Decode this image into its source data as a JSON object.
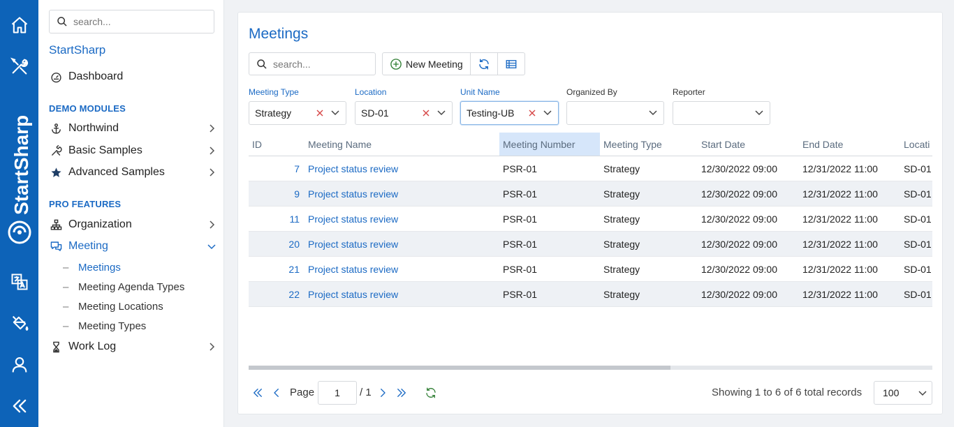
{
  "rail": {
    "brand": "StartSharp"
  },
  "sidebar": {
    "search_placeholder": "search...",
    "title": "StartSharp",
    "dashboard": "Dashboard",
    "section_demo": "DEMO MODULES",
    "northwind": "Northwind",
    "basic_samples": "Basic Samples",
    "advanced_samples": "Advanced Samples",
    "section_pro": "PRO FEATURES",
    "organization": "Organization",
    "meeting": "Meeting",
    "meeting_sub": [
      {
        "label": "Meetings"
      },
      {
        "label": "Meeting Agenda Types"
      },
      {
        "label": "Meeting Locations"
      },
      {
        "label": "Meeting Types"
      }
    ],
    "work_log": "Work Log"
  },
  "main": {
    "title": "Meetings",
    "search_placeholder": "search...",
    "new_button": "New Meeting",
    "filters": [
      {
        "label": "Meeting Type",
        "value": "Strategy"
      },
      {
        "label": "Location",
        "value": "SD-01"
      },
      {
        "label": "Unit Name",
        "value": "Testing-UB"
      },
      {
        "label": "Organized By",
        "value": ""
      },
      {
        "label": "Reporter",
        "value": ""
      }
    ],
    "columns": [
      "ID",
      "Meeting Name",
      "Meeting Number",
      "Meeting Type",
      "Start Date",
      "End Date",
      "Locati"
    ],
    "rows": [
      {
        "id": "7",
        "name": "Project status review",
        "number": "PSR-01",
        "type": "Strategy",
        "start": "12/30/2022 09:00",
        "end": "12/31/2022 11:00",
        "location": "SD-01"
      },
      {
        "id": "9",
        "name": "Project status review",
        "number": "PSR-01",
        "type": "Strategy",
        "start": "12/30/2022 09:00",
        "end": "12/31/2022 11:00",
        "location": "SD-01"
      },
      {
        "id": "11",
        "name": "Project status review",
        "number": "PSR-01",
        "type": "Strategy",
        "start": "12/30/2022 09:00",
        "end": "12/31/2022 11:00",
        "location": "SD-01"
      },
      {
        "id": "20",
        "name": "Project status review",
        "number": "PSR-01",
        "type": "Strategy",
        "start": "12/30/2022 09:00",
        "end": "12/31/2022 11:00",
        "location": "SD-01"
      },
      {
        "id": "21",
        "name": "Project status review",
        "number": "PSR-01",
        "type": "Strategy",
        "start": "12/30/2022 09:00",
        "end": "12/31/2022 11:00",
        "location": "SD-01"
      },
      {
        "id": "22",
        "name": "Project status review",
        "number": "PSR-01",
        "type": "Strategy",
        "start": "12/30/2022 09:00",
        "end": "12/31/2022 11:00",
        "location": "SD-01"
      }
    ],
    "pager": {
      "page_label": "Page",
      "page_value": "1",
      "page_total": "/ 1",
      "status": "Showing 1 to 6 of 6 total records",
      "page_size": "100"
    }
  },
  "colors": {
    "rail": "#0d63b8",
    "accent": "#1b6ac4",
    "sorted_header": "#d6e6fa",
    "alt_row": "#eef1f5"
  }
}
